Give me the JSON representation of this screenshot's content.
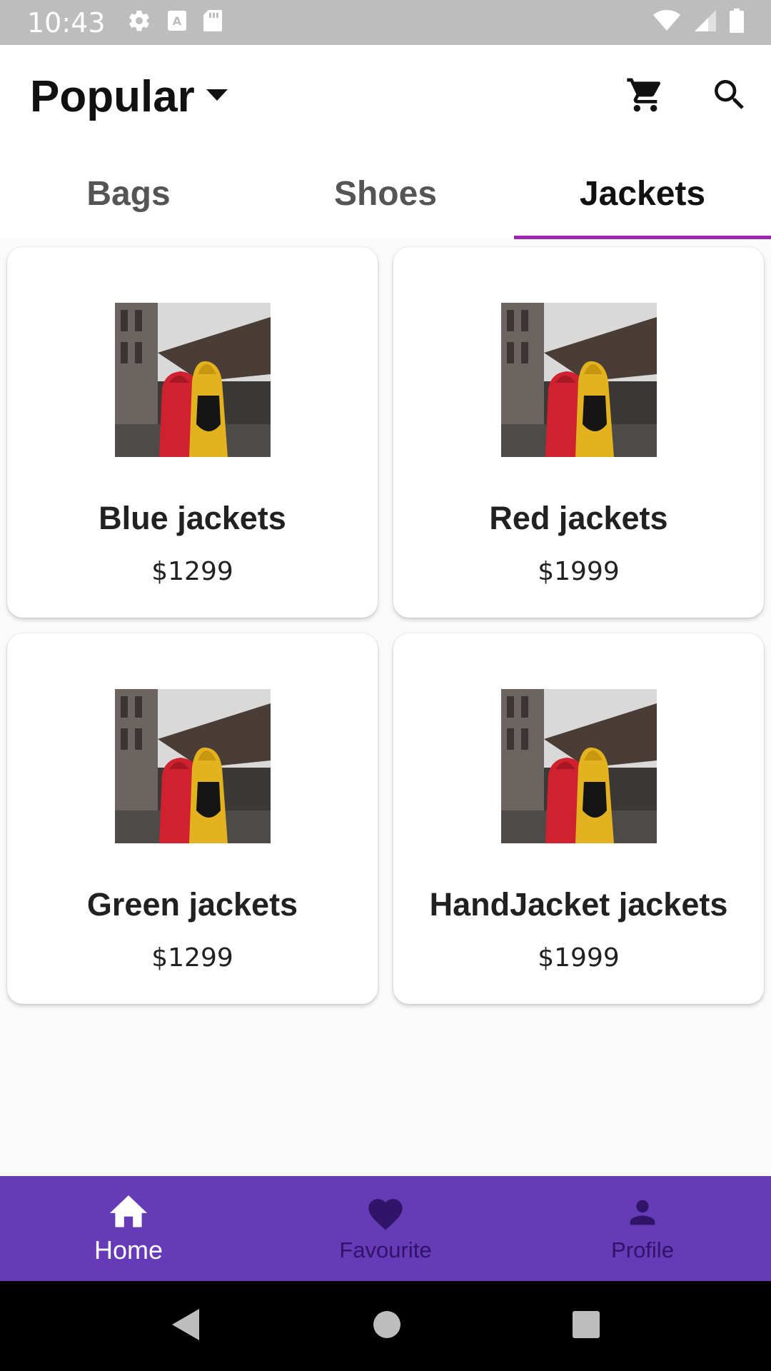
{
  "status_bar": {
    "time": "10:43"
  },
  "header": {
    "title": "Popular"
  },
  "tabs": [
    {
      "label": "Bags",
      "active": false
    },
    {
      "label": "Shoes",
      "active": false
    },
    {
      "label": "Jackets",
      "active": true
    }
  ],
  "products": [
    {
      "name": "Blue jackets",
      "price": "$1299"
    },
    {
      "name": "Red jackets",
      "price": "$1999"
    },
    {
      "name": "Green jackets",
      "price": "$1299"
    },
    {
      "name": "HandJacket jackets",
      "price": "$1999"
    }
  ],
  "bottom_nav": [
    {
      "label": "Home",
      "icon": "home-icon",
      "active": true
    },
    {
      "label": "Favourite",
      "icon": "heart-icon",
      "active": false
    },
    {
      "label": "Profile",
      "icon": "person-icon",
      "active": false
    }
  ],
  "colors": {
    "accent": "#9c27b0",
    "nav_bg": "#673ab7",
    "status_bar": "#bdbdbd"
  }
}
